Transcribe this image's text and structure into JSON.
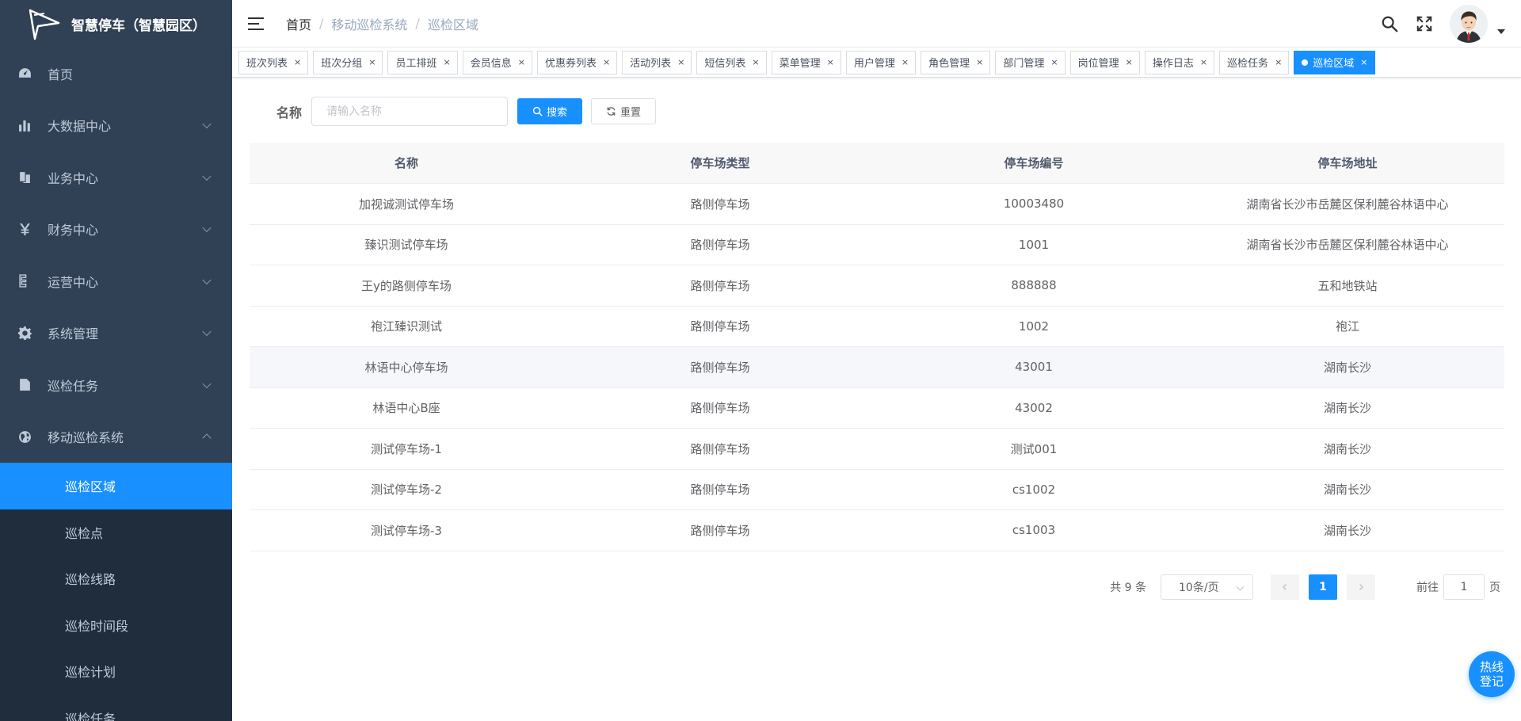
{
  "app": {
    "title": "智慧停车（智慧园区）"
  },
  "sidebar": {
    "menu": [
      {
        "label": "首页",
        "icon": "dashboard-icon",
        "has_arrow": false
      },
      {
        "label": "大数据中心",
        "icon": "chart-icon",
        "has_arrow": true
      },
      {
        "label": "业务中心",
        "icon": "documents-icon",
        "has_arrow": true
      },
      {
        "label": "财务中心",
        "icon": "yen-icon",
        "has_arrow": true
      },
      {
        "label": "运营中心",
        "icon": "tree-icon",
        "has_arrow": true
      },
      {
        "label": "系统管理",
        "icon": "gear-icon",
        "has_arrow": true
      },
      {
        "label": "巡检任务",
        "icon": "file-icon",
        "has_arrow": true
      },
      {
        "label": "移动巡检系统",
        "icon": "globe-icon",
        "has_arrow": true,
        "expanded": true
      }
    ],
    "submenu": [
      {
        "label": "巡检区域",
        "active": true
      },
      {
        "label": "巡检点"
      },
      {
        "label": "巡检线路"
      },
      {
        "label": "巡检时间段"
      },
      {
        "label": "巡检计划"
      },
      {
        "label": "巡检任务"
      }
    ]
  },
  "navbar": {
    "breadcrumb": [
      "首页",
      "移动巡检系统",
      "巡检区域"
    ]
  },
  "tags": [
    "班次列表",
    "班次分组",
    "员工排班",
    "会员信息",
    "优惠券列表",
    "活动列表",
    "短信列表",
    "菜单管理",
    "用户管理",
    "角色管理",
    "部门管理",
    "岗位管理",
    "操作日志",
    "巡检任务",
    "巡检区域"
  ],
  "search": {
    "label": "名称",
    "placeholder": "请输入名称",
    "search_label": "搜索",
    "reset_label": "重置"
  },
  "table": {
    "columns": [
      "名称",
      "停车场类型",
      "停车场编号",
      "停车场地址"
    ],
    "rows": [
      [
        "加视诚测试停车场",
        "路侧停车场",
        "10003480",
        "湖南省长沙市岳麓区保利麓谷林语中心"
      ],
      [
        "臻识测试停车场",
        "路侧停车场",
        "1001",
        "湖南省长沙市岳麓区保利麓谷林语中心"
      ],
      [
        "王y的路侧停车场",
        "路侧停车场",
        "888888",
        "五和地铁站"
      ],
      [
        "袍江臻识测试",
        "路侧停车场",
        "1002",
        "袍江"
      ],
      [
        "林语中心停车场",
        "路侧停车场",
        "43001",
        "湖南长沙"
      ],
      [
        "林语中心B座",
        "路侧停车场",
        "43002",
        "湖南长沙"
      ],
      [
        "测试停车场-1",
        "路侧停车场",
        "测试001",
        "湖南长沙"
      ],
      [
        "测试停车场-2",
        "路侧停车场",
        "cs1002",
        "湖南长沙"
      ],
      [
        "测试停车场-3",
        "路侧停车场",
        "cs1003",
        "湖南长沙"
      ]
    ],
    "hover_row": 4
  },
  "pagination": {
    "total_text": "共 9 条",
    "page_size": "10条/页",
    "current_page": "1",
    "goto_prefix": "前往",
    "goto_value": "1",
    "goto_suffix": "页"
  },
  "hotline": {
    "label": "热线登记"
  },
  "colors": {
    "primary": "#1890ff",
    "sidebar_bg": "#304156",
    "submenu_bg": "#1f2d3d"
  }
}
